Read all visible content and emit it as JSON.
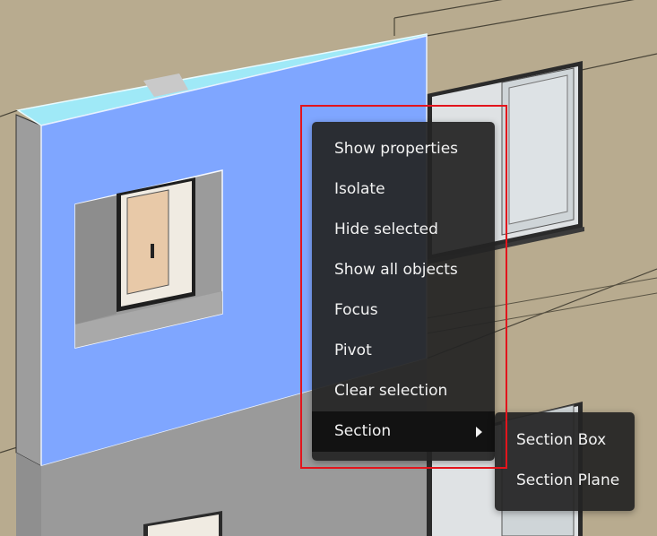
{
  "context_menu": {
    "items": [
      {
        "label": "Show properties"
      },
      {
        "label": "Isolate"
      },
      {
        "label": "Hide selected"
      },
      {
        "label": "Show all objects"
      },
      {
        "label": "Focus"
      },
      {
        "label": "Pivot"
      },
      {
        "label": "Clear selection"
      },
      {
        "label": "Section",
        "has_submenu": true,
        "active": true
      }
    ]
  },
  "section_submenu": {
    "items": [
      {
        "label": "Section Box"
      },
      {
        "label": "Section Plane"
      }
    ]
  },
  "colors": {
    "selected_wall": "#7fa6ff",
    "menu_background": "#242424",
    "annotation_outline": "#e3141c",
    "facade": "#b8ab8f"
  }
}
